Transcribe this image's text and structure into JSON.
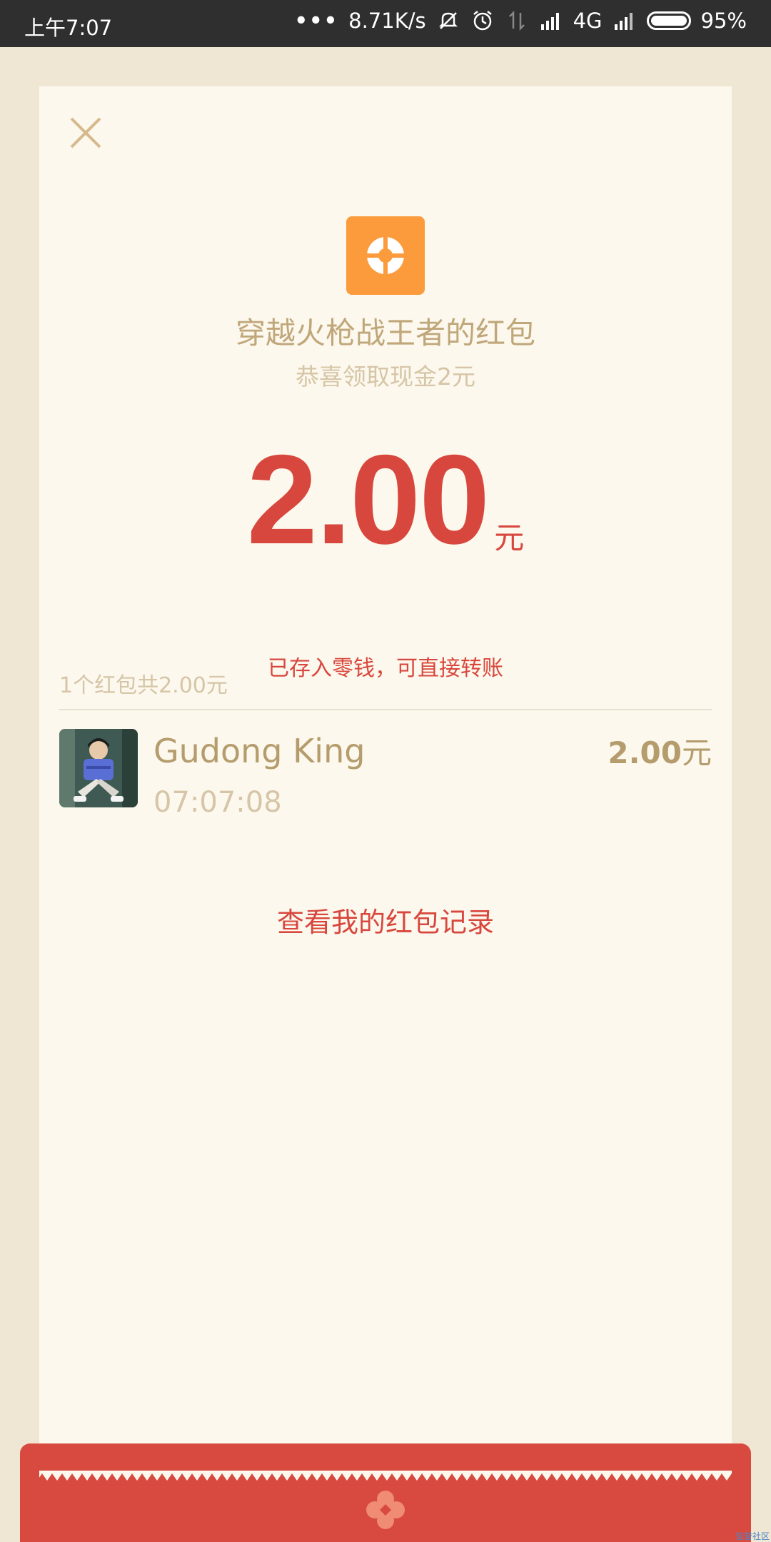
{
  "status_bar": {
    "time": "上午7:07",
    "dots": "•••",
    "net_speed": "8.71K/s",
    "network": "4G",
    "battery": "95%",
    "icons": [
      "mute-icon",
      "alarm-icon",
      "data-arrows-icon",
      "signal-icon",
      "signal-icon",
      "battery-icon"
    ]
  },
  "packet": {
    "title": "穿越火枪战王者的红包",
    "subtitle": "恭喜领取现金2元",
    "amount": "2.00",
    "unit": "元",
    "deposit_note": "已存入零钱，可直接转账"
  },
  "list": {
    "summary": "1个红包共2.00元",
    "entries": [
      {
        "name": "Gudong King",
        "time": "07:07:08",
        "amount": "2.00",
        "unit": "元"
      }
    ]
  },
  "records_link": "查看我的红包记录",
  "watermark": "信誉社区",
  "colors": {
    "accent_red": "#d8473d",
    "gold_text": "#b59c6d",
    "logo_orange": "#fb9b3c",
    "card_bg": "#fcf8ed",
    "page_bg": "#efe6d4"
  }
}
